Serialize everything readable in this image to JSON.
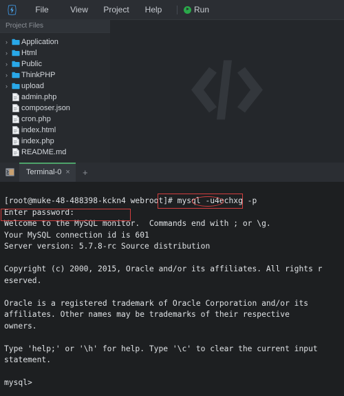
{
  "window": {
    "logo_icon": "lightning-bolt-logo"
  },
  "menubar": {
    "items": [
      {
        "label": "File"
      },
      {
        "label": "View"
      },
      {
        "label": "Project"
      },
      {
        "label": "Help"
      }
    ],
    "run": {
      "label": "Run",
      "icon": "play-circle-icon",
      "color": "#2aa84a"
    }
  },
  "sidebar": {
    "title": "Project Files",
    "tree": [
      {
        "name": "Application",
        "type": "folder",
        "expanded": false,
        "chevron": "›"
      },
      {
        "name": "Html",
        "type": "folder",
        "expanded": false,
        "chevron": "›"
      },
      {
        "name": "Public",
        "type": "folder",
        "expanded": false,
        "chevron": "›"
      },
      {
        "name": "ThinkPHP",
        "type": "folder",
        "expanded": false,
        "chevron": "›"
      },
      {
        "name": "upload",
        "type": "folder",
        "expanded": false,
        "chevron": "›"
      },
      {
        "name": "admin.php",
        "type": "file",
        "chevron": ""
      },
      {
        "name": "composer.json",
        "type": "file",
        "chevron": ""
      },
      {
        "name": "cron.php",
        "type": "file",
        "chevron": ""
      },
      {
        "name": "index.html",
        "type": "file",
        "chevron": ""
      },
      {
        "name": "index.php",
        "type": "file",
        "chevron": ""
      },
      {
        "name": "README.md",
        "type": "file",
        "chevron": ""
      }
    ]
  },
  "editor": {
    "watermark_icon": "code-brackets-watermark"
  },
  "terminal_tabs": {
    "panel_icon": "terminal-icon",
    "tabs": [
      {
        "label": "Terminal-0",
        "active": true,
        "close_label": "×"
      }
    ],
    "add_label": "+"
  },
  "terminal": {
    "lines": [
      "[root@muke-48-488398-kckn4 webroot]# mysql -u4echxg -p",
      "Enter password:",
      "Welcome to the MySQL monitor.  Commands end with ; or \\g.",
      "Your MySQL connection id is 601",
      "Server version: 5.7.8-rc Source distribution",
      "",
      "Copyright (c) 2000, 2015, Oracle and/or its affiliates. All rights r",
      "eserved.",
      "",
      "Oracle is a registered trademark of Oracle Corporation and/or its",
      "affiliates. Other names may be trademarks of their respective",
      "owners.",
      "",
      "Type 'help;' or '\\h' for help. Type '\\c' to clear the current input",
      "statement.",
      "",
      "mysql>"
    ],
    "prompt": "[root@muke-48-488398-kckn4 webroot]#",
    "command": "mysql -u4echxg -p",
    "highlighted_user": "4echxg",
    "password_prompt": "Enter password:"
  },
  "annotations": {
    "color": "#d43f3f",
    "boxes": [
      {
        "name": "command-highlight",
        "label": "mysql -u4echxg -p"
      },
      {
        "name": "password-highlight",
        "label": "Enter password:"
      }
    ],
    "ellipses": [
      {
        "name": "username-circle",
        "label": "4echxg"
      }
    ]
  }
}
